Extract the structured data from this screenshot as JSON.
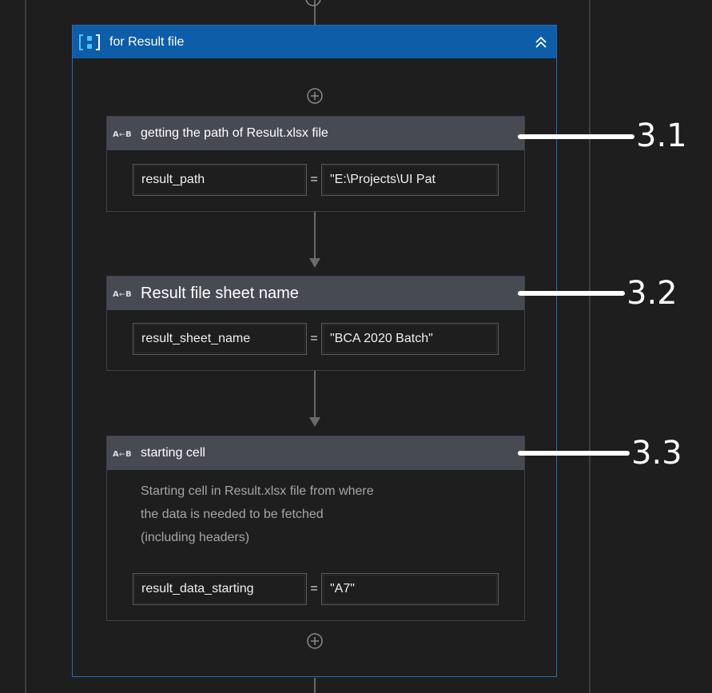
{
  "sequence": {
    "title": "for Result file",
    "icon": "sequence-brackets-icon",
    "collapse_icon": "double-chevron-up-icon"
  },
  "activities": [
    {
      "title": "getting the path of Result.xlsx file",
      "icon": "assign-icon",
      "variable": "result_path",
      "equals": "=",
      "value": "\"E:\\Projects\\UI Pat"
    },
    {
      "title": "Result file sheet name",
      "icon": "assign-icon",
      "variable": "result_sheet_name",
      "equals": "=",
      "value": "\"BCA 2020 Batch\""
    },
    {
      "title": "starting cell",
      "icon": "assign-icon",
      "annotation_lines": [
        "Starting cell in Result.xlsx file from where",
        "the data is needed to be fetched",
        "(including headers)"
      ],
      "variable": "result_data_starting",
      "equals": "=",
      "value": "\"A7\""
    }
  ],
  "callouts": [
    "3.1",
    "3.2",
    "3.3"
  ],
  "colors": {
    "background": "#1e1e1e",
    "sequence_header": "#0d5da8",
    "activity_header": "#484a53",
    "annotation_text": "#a6a6a6",
    "callout": "#ffffff"
  }
}
